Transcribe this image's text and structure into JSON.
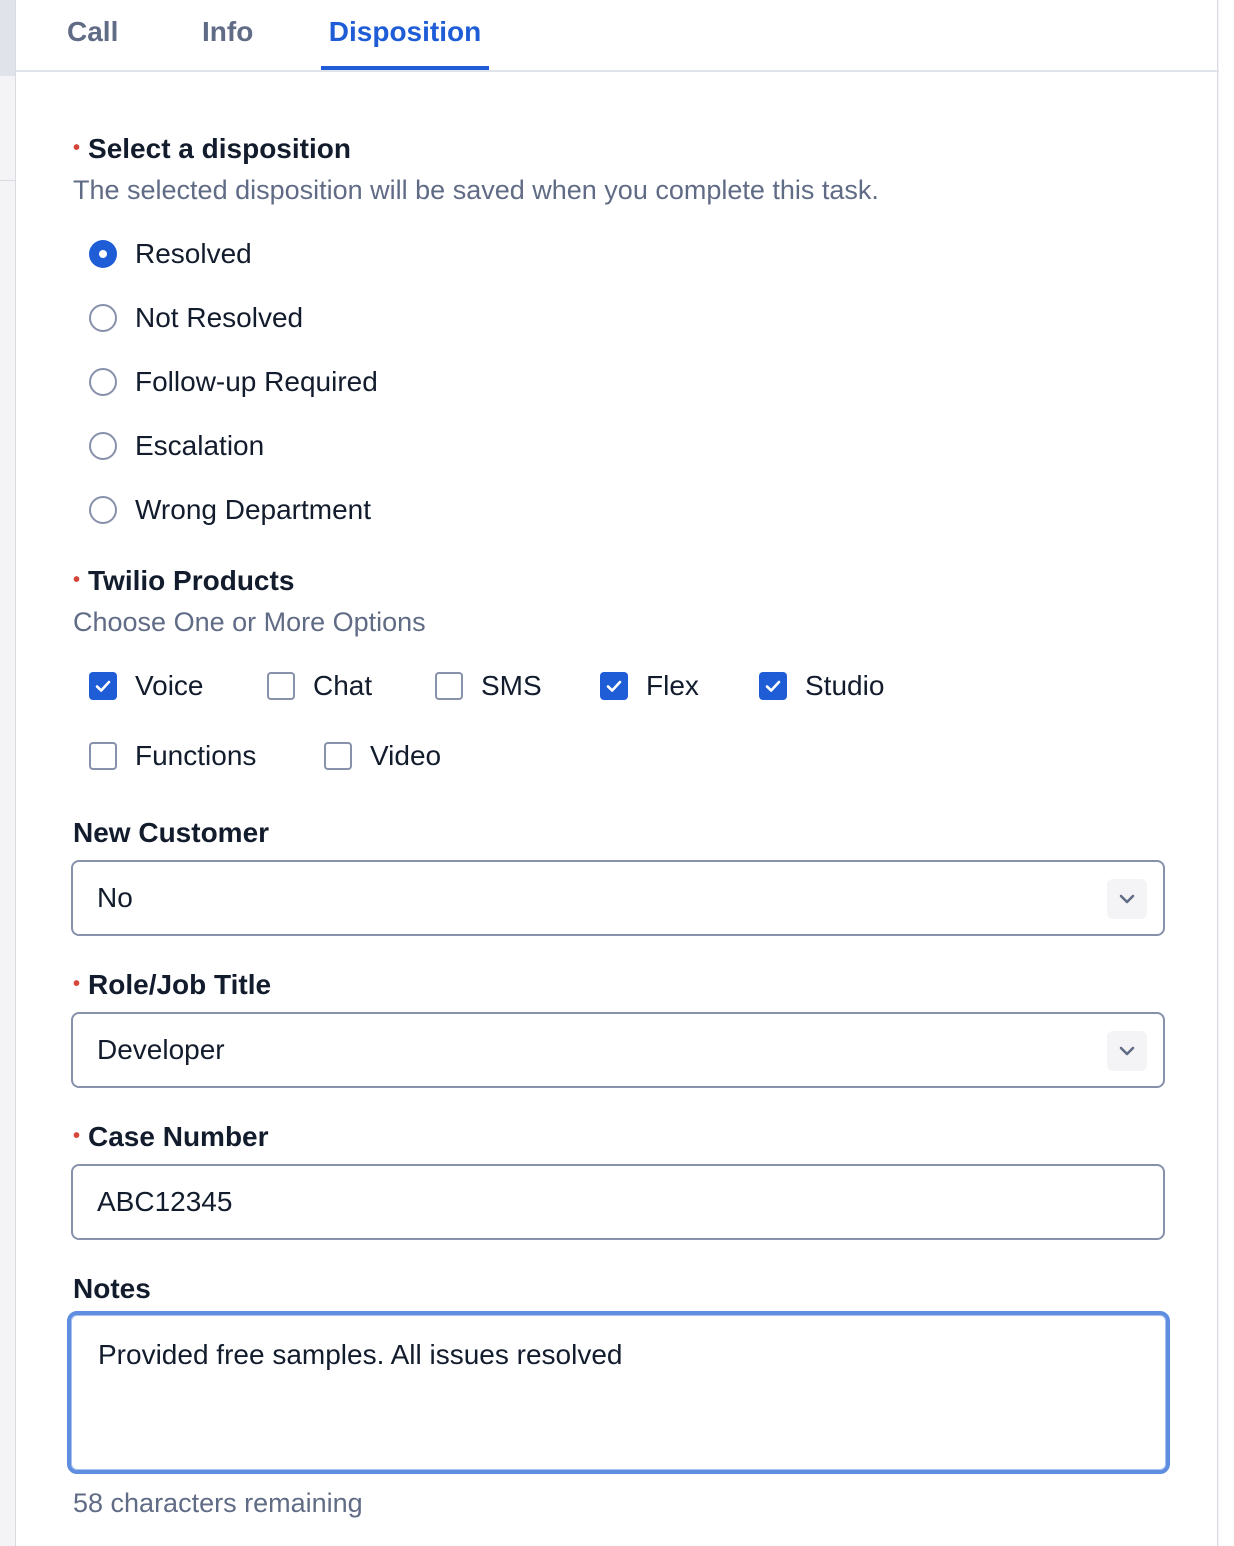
{
  "tabs": [
    {
      "label": "Call"
    },
    {
      "label": "Info"
    },
    {
      "label": "Disposition",
      "active": true
    }
  ],
  "disposition": {
    "label": "Select a disposition",
    "required": true,
    "help": "The selected disposition will be saved when you complete this task.",
    "options": [
      {
        "label": "Resolved",
        "checked": true
      },
      {
        "label": "Not Resolved",
        "checked": false
      },
      {
        "label": "Follow-up Required",
        "checked": false
      },
      {
        "label": "Escalation",
        "checked": false
      },
      {
        "label": "Wrong Department",
        "checked": false
      }
    ]
  },
  "products": {
    "label": "Twilio Products",
    "required": true,
    "help": "Choose One or More Options",
    "options": [
      {
        "label": "Voice",
        "checked": true
      },
      {
        "label": "Chat",
        "checked": false
      },
      {
        "label": "SMS",
        "checked": false
      },
      {
        "label": "Flex",
        "checked": true
      },
      {
        "label": "Studio",
        "checked": true
      },
      {
        "label": "Functions",
        "checked": false
      },
      {
        "label": "Video",
        "checked": false
      }
    ]
  },
  "new_customer": {
    "label": "New Customer",
    "value": "No"
  },
  "role": {
    "label": "Role/Job Title",
    "required": true,
    "value": "Developer"
  },
  "case_number": {
    "label": "Case Number",
    "required": true,
    "value": "ABC12345"
  },
  "notes": {
    "label": "Notes",
    "value": "Provided free samples. All issues resolved",
    "counter": "58 characters remaining"
  },
  "required_marker": "•",
  "colors": {
    "accent": "#1f5dd6",
    "required": "#d6473b",
    "focus_border": "#5f8ee0"
  }
}
